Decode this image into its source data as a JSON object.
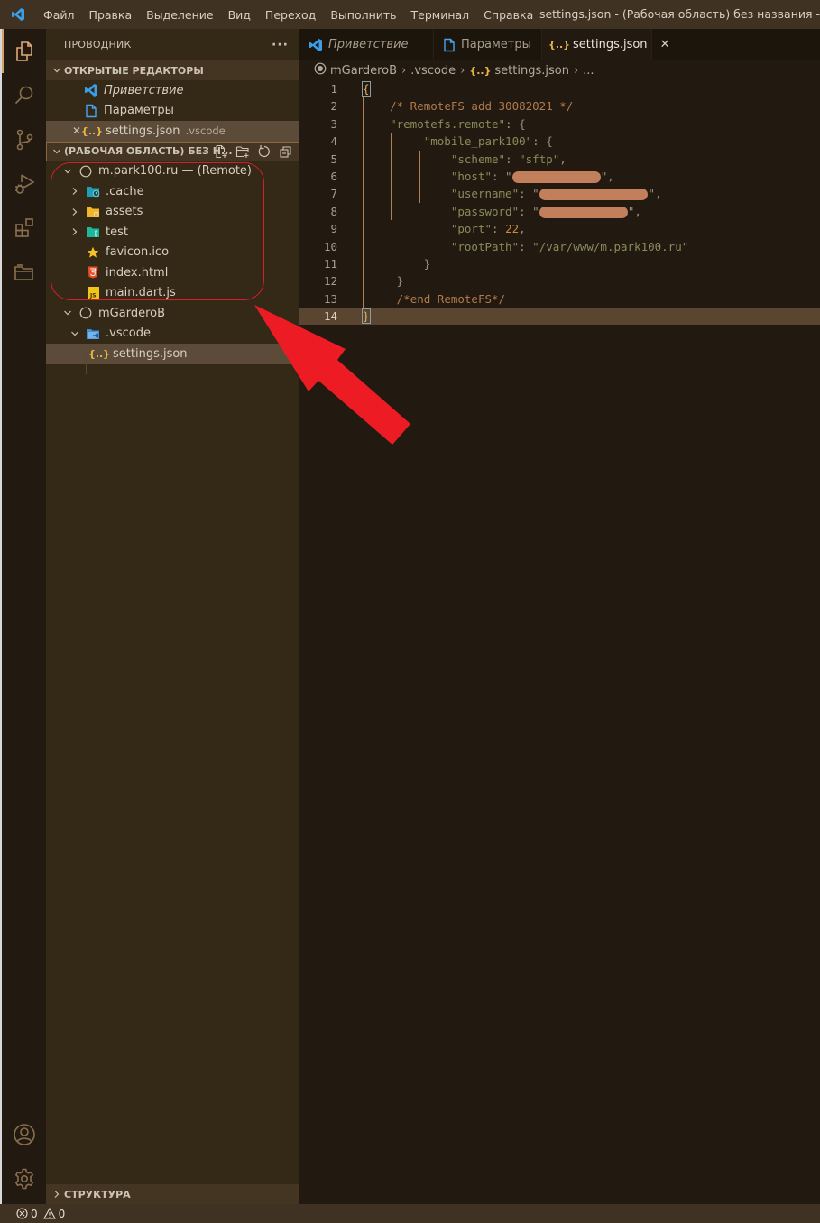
{
  "titlebar": {
    "menu": [
      "Файл",
      "Правка",
      "Выделение",
      "Вид",
      "Переход",
      "Выполнить",
      "Терминал",
      "Справка"
    ],
    "window_title": "settings.json - (Рабочая область) без названия -"
  },
  "activitybar": {
    "items": [
      {
        "name": "explorer",
        "icon": "files-icon",
        "active": true
      },
      {
        "name": "search",
        "icon": "search-icon"
      },
      {
        "name": "source-control",
        "icon": "source-control-icon"
      },
      {
        "name": "run-debug",
        "icon": "run-debug-icon"
      },
      {
        "name": "extensions",
        "icon": "extensions-icon"
      },
      {
        "name": "remote-explorer",
        "icon": "folder-icon"
      }
    ],
    "bottom": [
      {
        "name": "accounts",
        "icon": "account-icon"
      },
      {
        "name": "manage",
        "icon": "gear-icon"
      }
    ]
  },
  "sidebar": {
    "title": "ПРОВОДНИК",
    "more_label": "···",
    "open_editors": {
      "label": "ОТКРЫТЫЕ РЕДАКТОРЫ",
      "items": [
        {
          "label": "Приветствие",
          "icon": "vscode-logo-icon",
          "italic": true
        },
        {
          "label": "Параметры",
          "icon": "file-icon"
        },
        {
          "label": "settings.json",
          "desc": ".vscode",
          "icon": "json-icon",
          "selected": true,
          "close": "✕"
        }
      ]
    },
    "workspace": {
      "label": "(РАБОЧАЯ ОБЛАСТЬ) БЕЗ Н...",
      "actions": [
        "new-file",
        "new-folder",
        "refresh",
        "collapse-all"
      ],
      "folders": [
        {
          "label": "m.park100.ru — (Remote)",
          "children": [
            {
              "label": ".cache",
              "type": "folder",
              "icon": "folder-cache-icon"
            },
            {
              "label": "assets",
              "type": "folder",
              "icon": "folder-assets-icon"
            },
            {
              "label": "test",
              "type": "folder",
              "icon": "folder-test-icon"
            },
            {
              "label": "favicon.ico",
              "type": "file",
              "icon": "star-icon"
            },
            {
              "label": "index.html",
              "type": "file",
              "icon": "html5-icon"
            },
            {
              "label": "main.dart.js",
              "type": "file",
              "icon": "js-icon"
            }
          ]
        },
        {
          "label": "mGarderoB",
          "children": [
            {
              "label": ".vscode",
              "type": "folder",
              "icon": "folder-vscode-icon",
              "expanded": true,
              "children": [
                {
                  "label": "settings.json",
                  "icon": "json-icon",
                  "selected": true
                }
              ]
            }
          ]
        }
      ]
    },
    "structure_label": "СТРУКТУРА"
  },
  "editor": {
    "tabs": [
      {
        "label": "Приветствие",
        "icon": "vscode-logo-icon",
        "italic": true
      },
      {
        "label": "Параметры",
        "icon": "file-icon"
      },
      {
        "label": "settings.json",
        "icon": "json-icon",
        "active": true,
        "close": "✕"
      }
    ],
    "breadcrumb": [
      "mGarderoB",
      ".vscode",
      "settings.json",
      "..."
    ],
    "lines": [
      {
        "n": "1",
        "tokens": [
          {
            "t": "{",
            "c": "tok-bracket-hl"
          }
        ]
      },
      {
        "n": "2",
        "tokens": [
          {
            "t": "    "
          },
          {
            "t": "/* RemoteFS add 30082021 */",
            "c": "tok-comment"
          }
        ]
      },
      {
        "n": "3",
        "tokens": [
          {
            "t": "    "
          },
          {
            "t": "\"remotefs.remote\"",
            "c": "tok-key"
          },
          {
            "t": ": {",
            "c": "tok-punc"
          }
        ]
      },
      {
        "n": "4",
        "tokens": [
          {
            "t": "         "
          },
          {
            "t": "\"mobile_park100\"",
            "c": "tok-key"
          },
          {
            "t": ": {",
            "c": "tok-punc"
          }
        ]
      },
      {
        "n": "5",
        "tokens": [
          {
            "t": "             "
          },
          {
            "t": "\"scheme\"",
            "c": "tok-key"
          },
          {
            "t": ": ",
            "c": "tok-punc"
          },
          {
            "t": "\"sftp\"",
            "c": "tok-str"
          },
          {
            "t": ",",
            "c": "tok-punc"
          }
        ]
      },
      {
        "n": "6",
        "tokens": [
          {
            "t": "             "
          },
          {
            "t": "\"host\"",
            "c": "tok-key"
          },
          {
            "t": ": \"",
            "c": "tok-punc"
          },
          {
            "redact": 13
          },
          {
            "t": "\",",
            "c": "tok-punc"
          }
        ]
      },
      {
        "n": "7",
        "tokens": [
          {
            "t": "             "
          },
          {
            "t": "\"username\"",
            "c": "tok-key"
          },
          {
            "t": ": \"",
            "c": "tok-punc"
          },
          {
            "redact": 16
          },
          {
            "t": "\",",
            "c": "tok-punc"
          }
        ]
      },
      {
        "n": "8",
        "tokens": [
          {
            "t": "             "
          },
          {
            "t": "\"password\"",
            "c": "tok-key"
          },
          {
            "t": ": \"",
            "c": "tok-punc"
          },
          {
            "redact": 13
          },
          {
            "t": "\",",
            "c": "tok-punc"
          }
        ]
      },
      {
        "n": "9",
        "tokens": [
          {
            "t": "             "
          },
          {
            "t": "\"port\"",
            "c": "tok-key"
          },
          {
            "t": ": ",
            "c": "tok-punc"
          },
          {
            "t": "22",
            "c": "tok-num"
          },
          {
            "t": ",",
            "c": "tok-punc"
          }
        ]
      },
      {
        "n": "10",
        "tokens": [
          {
            "t": "             "
          },
          {
            "t": "\"rootPath\"",
            "c": "tok-key"
          },
          {
            "t": ": ",
            "c": "tok-punc"
          },
          {
            "t": "\"/var/www/m.park100.ru\"",
            "c": "tok-str"
          }
        ]
      },
      {
        "n": "11",
        "tokens": [
          {
            "t": "         "
          },
          {
            "t": "}",
            "c": "tok-punc"
          }
        ]
      },
      {
        "n": "12",
        "tokens": [
          {
            "t": "     "
          },
          {
            "t": "}",
            "c": "tok-punc"
          }
        ]
      },
      {
        "n": "13",
        "tokens": [
          {
            "t": "     "
          },
          {
            "t": "/*end RemoteFS*/",
            "c": "tok-comment"
          }
        ]
      },
      {
        "n": "14",
        "tokens": [
          {
            "t": "}",
            "c": "tok-bracket-hl"
          }
        ],
        "current": true
      }
    ]
  },
  "statusbar": {
    "errors": "0",
    "warnings": "0"
  },
  "annotation": {
    "type": "red-arrow-and-ellipse",
    "color": "#ed1c24",
    "target": "m.park100.ru — (Remote)"
  },
  "colors": {
    "accent": "#d3a36b",
    "vscode_blue": "#3b9fe8",
    "json_yellow": "#e8b847"
  }
}
